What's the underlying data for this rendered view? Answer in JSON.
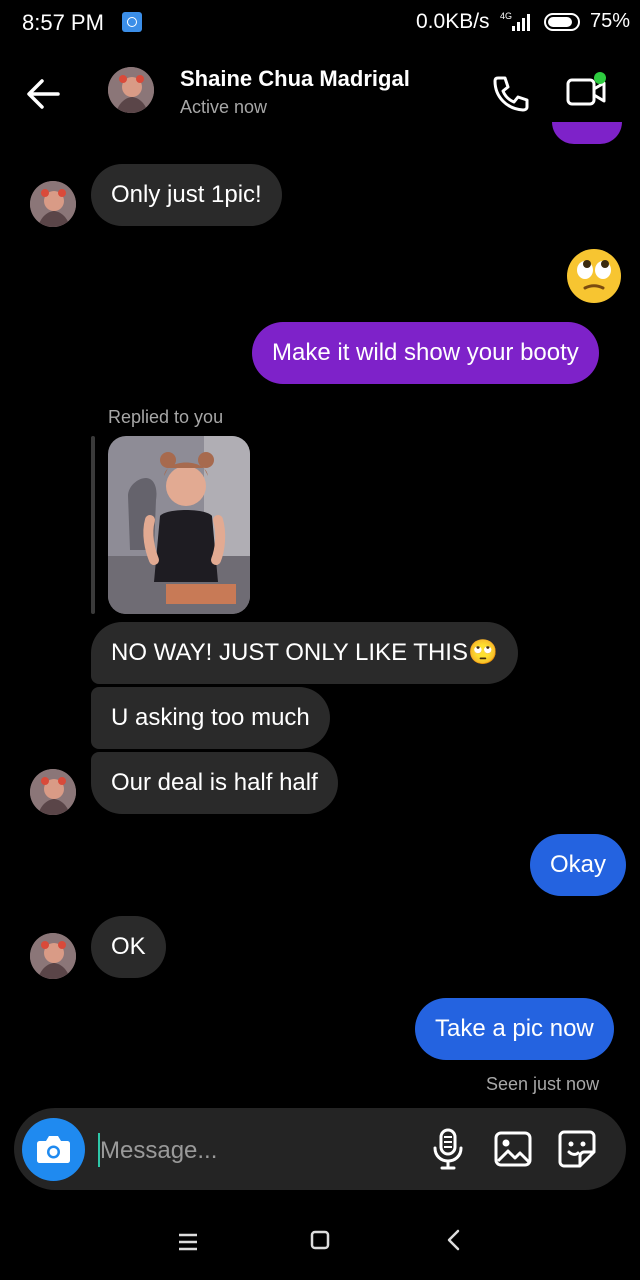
{
  "status_bar": {
    "time": "8:57 PM",
    "net_speed": "0.0KB/s",
    "network": "4G",
    "battery": "75%"
  },
  "header": {
    "contact_name": "Shaine Chua Madrigal",
    "status": "Active now"
  },
  "messages": [
    {
      "from": "them",
      "text": "Only just 1pic!"
    },
    {
      "from": "me",
      "emoji": "eye-roll-emoji"
    },
    {
      "from": "me",
      "text": "Make it wild show your booty"
    },
    {
      "from": "them",
      "reply_label": "Replied to you"
    },
    {
      "from": "them",
      "text": "NO WAY! JUST ONLY LIKE THIS🙄"
    },
    {
      "from": "them",
      "text": "U asking too much"
    },
    {
      "from": "them",
      "text": "Our deal is half half"
    },
    {
      "from": "me",
      "text": "Okay"
    },
    {
      "from": "them",
      "text": "OK"
    },
    {
      "from": "me",
      "text": "Take a pic now"
    }
  ],
  "seen_status": "Seen just now",
  "composer": {
    "placeholder": "Message..."
  },
  "colors": {
    "accent_blue": "#2463e0",
    "accent_purple": "#7e22c9",
    "incoming_bubble": "#2a2a2a",
    "online_dot": "#2ecc40"
  }
}
